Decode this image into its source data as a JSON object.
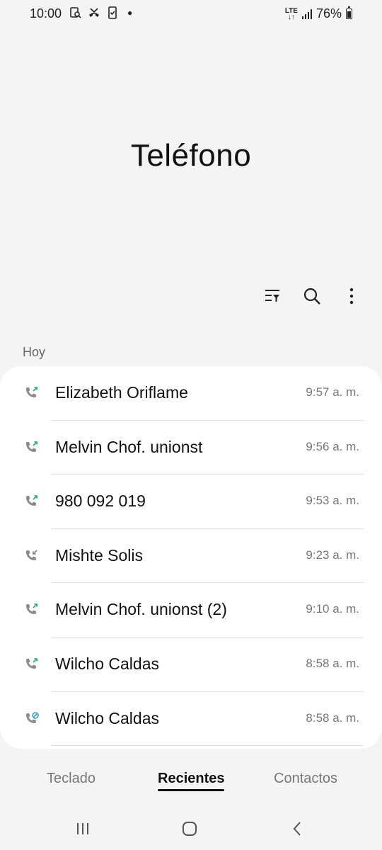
{
  "status_bar": {
    "time": "10:00",
    "network": "LTE",
    "battery": "76%",
    "icons": [
      "screen-search-icon",
      "missed-call-icon",
      "phone-check-icon"
    ]
  },
  "app": {
    "title": "Teléfono"
  },
  "toolbar": {
    "icons": [
      "filter-icon",
      "search-icon",
      "more-options-icon"
    ]
  },
  "calls": {
    "section_label": "Hoy",
    "items": [
      {
        "name": "Elizabeth Oriflame",
        "time": "9:57 a. m.",
        "type": "outgoing"
      },
      {
        "name": "Melvin Chof. unionst",
        "time": "9:56 a. m.",
        "type": "outgoing"
      },
      {
        "name": "980 092 019",
        "time": "9:53 a. m.",
        "type": "outgoing"
      },
      {
        "name": "Mishte Solis",
        "time": "9:23 a. m.",
        "type": "incoming"
      },
      {
        "name": "Melvin Chof. unionst (2)",
        "time": "9:10 a. m.",
        "type": "outgoing"
      },
      {
        "name": "Wilcho Caldas",
        "time": "8:58 a. m.",
        "type": "outgoing"
      },
      {
        "name": "Wilcho Caldas",
        "time": "8:58 a. m.",
        "type": "blocked"
      }
    ]
  },
  "tabs": [
    {
      "label": "Teclado",
      "active": false
    },
    {
      "label": "Recientes",
      "active": true
    },
    {
      "label": "Contactos",
      "active": false
    }
  ],
  "colors": {
    "outgoing_arrow": "#2bb673",
    "blocked_accent": "#3a9fd8",
    "phone_icon": "#8a8a8a"
  }
}
